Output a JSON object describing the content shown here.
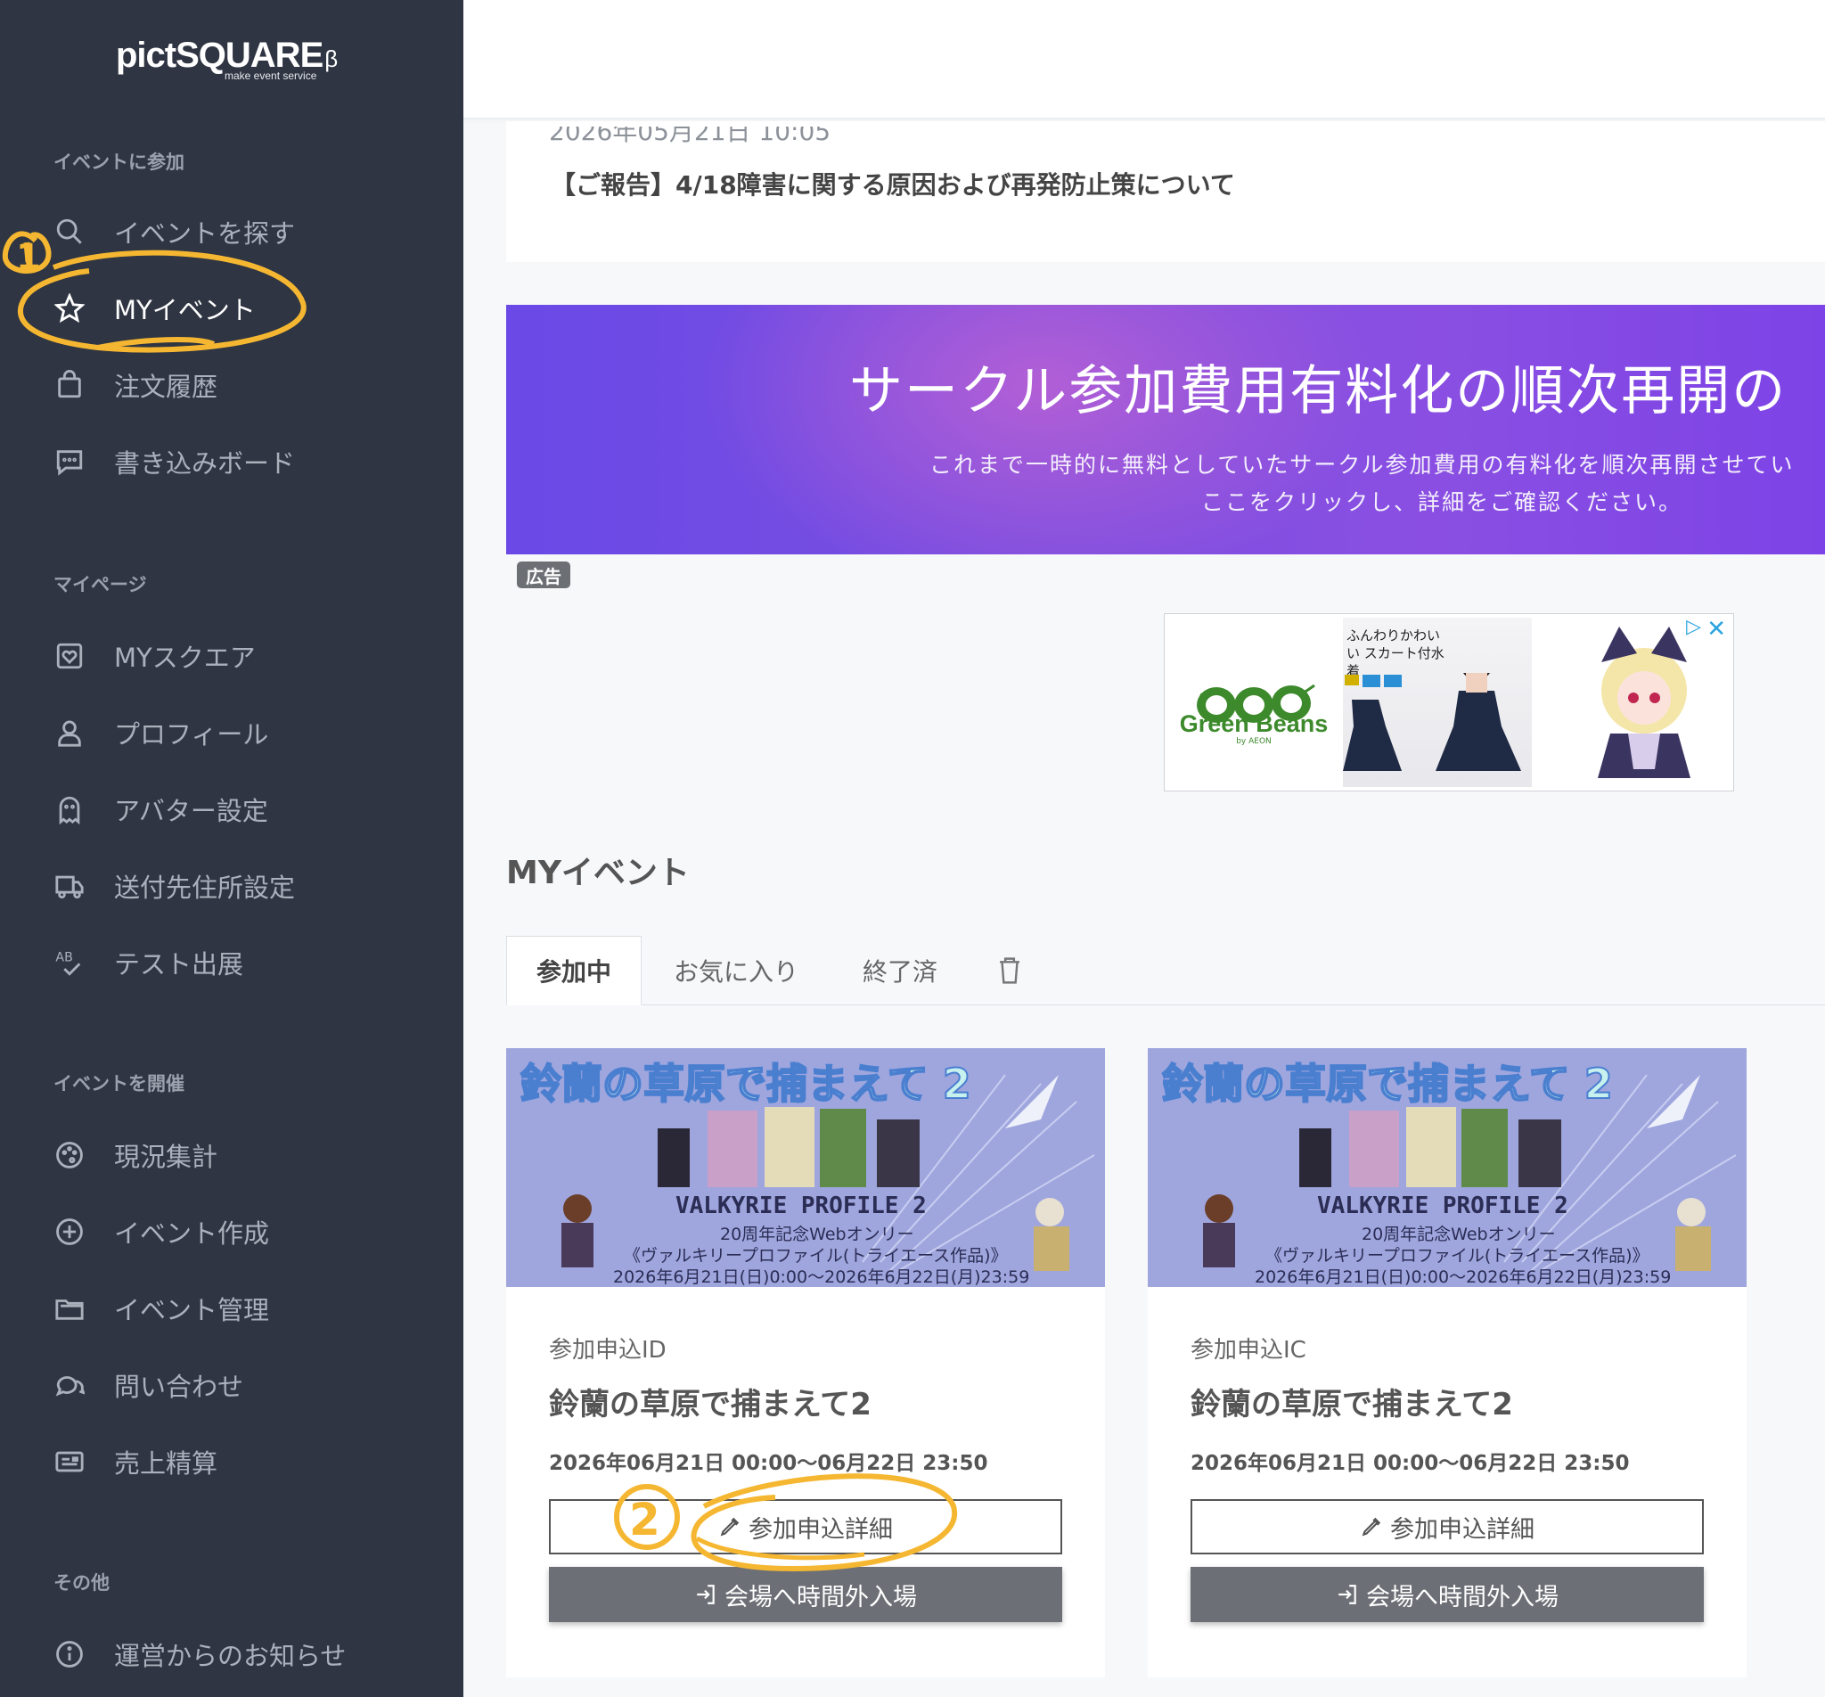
{
  "app": {
    "logo": "pictSQUARE",
    "logo_beta": "β",
    "logo_sub": "make event service"
  },
  "sidebar": {
    "sections": [
      {
        "title": "イベントに参加",
        "items": [
          {
            "label": "イベントを探す",
            "icon": "search-icon"
          },
          {
            "label": "MYイベント",
            "icon": "star-icon",
            "active": true
          },
          {
            "label": "注文履歴",
            "icon": "shopping-bag-icon"
          },
          {
            "label": "書き込みボード",
            "icon": "message-board-icon"
          }
        ]
      },
      {
        "title": "マイページ",
        "items": [
          {
            "label": "MYスクエア",
            "icon": "heart-frame-icon"
          },
          {
            "label": "プロフィール",
            "icon": "user-icon"
          },
          {
            "label": "アバター設定",
            "icon": "ghost-icon"
          },
          {
            "label": "送付先住所設定",
            "icon": "truck-icon"
          },
          {
            "label": "テスト出展",
            "icon": "ab-check-icon"
          }
        ]
      },
      {
        "title": "イベントを開催",
        "items": [
          {
            "label": "現況集計",
            "icon": "palette-icon"
          },
          {
            "label": "イベント作成",
            "icon": "plus-circle-icon"
          },
          {
            "label": "イベント管理",
            "icon": "folder-icon"
          },
          {
            "label": "問い合わせ",
            "icon": "chat-icon"
          },
          {
            "label": "売上精算",
            "icon": "id-card-icon"
          }
        ]
      },
      {
        "title": "その他",
        "items": [
          {
            "label": "運営からのお知らせ",
            "icon": "info-icon"
          }
        ]
      }
    ]
  },
  "news": {
    "date": "2026年05月21日 10:05",
    "title": "【ご報告】4/18障害に関する原因および再発防止策について"
  },
  "banner": {
    "title": "サークル参加費用有料化の順次再開の",
    "line1": "これまで一時的に無料としていたサークル参加費用の有料化を順次再開させてい",
    "line2": "ここをクリックし、詳細をご確認ください。",
    "ad_label": "広告"
  },
  "ad": {
    "brand": "Green Beans",
    "brand_sub": "by AEON",
    "product_text": "ふんわりかわいい スカート付水着",
    "badges": [
      "UV",
      "UPF 50+",
      "ストレッチ"
    ]
  },
  "my_events": {
    "title": "MYイベント",
    "tabs": [
      {
        "label": "参加中",
        "active": true
      },
      {
        "label": "お気に入り"
      },
      {
        "label": "終了済"
      }
    ],
    "cards": [
      {
        "banner_title": "鈴蘭の草原で捕まえて 2",
        "banner_game": "VALKYRIE PROFILE 2",
        "banner_line1": "20周年記念Webオンリー",
        "banner_line2": "《ヴァルキリープロファイル(トライエース作品)》",
        "banner_line3": "2026年6月21日(日)0:00〜2026年6月22日(月)23:59",
        "id_label": "参加申込ID",
        "title": "鈴蘭の草原で捕まえて2",
        "date": "2026年06月21日 00:00〜06月22日 23:50",
        "detail_button": "参加申込詳細",
        "enter_button": "会場へ時間外入場"
      },
      {
        "banner_title": "鈴蘭の草原で捕まえて 2",
        "banner_game": "VALKYRIE PROFILE 2",
        "banner_line1": "20周年記念Webオンリー",
        "banner_line2": "《ヴァルキリープロファイル(トライエース作品)》",
        "banner_line3": "2026年6月21日(日)0:00〜2026年6月22日(月)23:59",
        "id_label": "参加申込IC",
        "title": "鈴蘭の草原で捕まえて2",
        "date": "2026年06月21日 00:00〜06月22日 23:50",
        "detail_button": "参加申込詳細",
        "enter_button": "会場へ時間外入場"
      }
    ]
  },
  "annotations": {
    "color": "#f5b731",
    "marks": [
      "1",
      "2"
    ]
  },
  "colors": {
    "sidebar_bg": "#2f3542",
    "accent": "#7a4ee0",
    "button_dark": "#6c7076"
  }
}
